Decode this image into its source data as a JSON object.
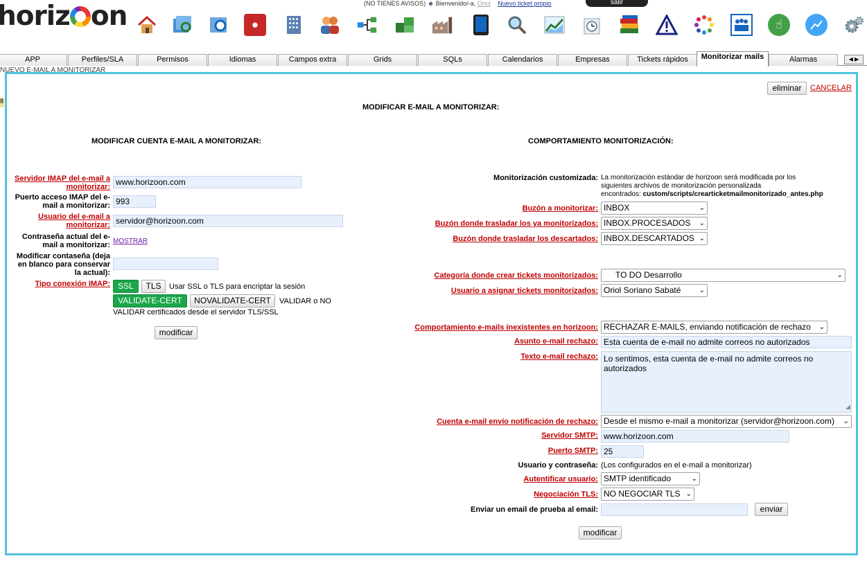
{
  "header": {
    "logo_text": "horizoon",
    "notices": "(NO TIENES AVISOS)",
    "welcome": "Bienvenido/-a,",
    "user": "Oriol",
    "new_ticket": "Nuevo ticket propio",
    "logout": "salir"
  },
  "toolbar_icons": [
    "home-icon",
    "search-images-icon",
    "search-list-icon",
    "map-marker-icon",
    "building-icon",
    "users-icon",
    "org-chart-icon",
    "boxes-icon",
    "factory-icon",
    "tablet-icon",
    "magnifier-icon",
    "chart-icon",
    "clock-icon",
    "books-icon",
    "warning-icon",
    "dots-circle-icon",
    "team-icon",
    "touch-icon",
    "trend-icon",
    "gears-icon"
  ],
  "tabs": [
    "APP",
    "Perfiles/SLA",
    "Permisos",
    "Idiomas",
    "Campos extra",
    "Grids",
    "SQLs",
    "Calendarios",
    "Empresas",
    "Tickets rápidos",
    "Monitorizar mails",
    "Alarmas"
  ],
  "active_tab": "Monitorizar mails",
  "breadcrumb": "NUEVO E-MAIL A MONITORIZAR",
  "page": {
    "delete_label": "eliminar",
    "cancel_label": "CANCELAR",
    "main_title": "MODIFICAR E-MAIL A MONITORIZAR:"
  },
  "left": {
    "title": "MODIFICAR CUENTA E-MAIL A MONITORIZAR:",
    "imap_server_label": "Servidor IMAP del e-mail a monitorizar:",
    "imap_server_value": "www.horizoon.com",
    "imap_port_label": "Puerto acceso IMAP del e-mail a monitorizar:",
    "imap_port_value": "993",
    "user_label": "Usuario del e-mail a monitorizar:",
    "user_value": "servidor@horizoon.com",
    "current_password_label": "Contraseña actual del e-mail a monitorizar:",
    "show_label": "MOSTRAR",
    "new_password_label": "Modificar contaseña (deja en blanco para conservar la actual):",
    "new_password_value": "",
    "conn_type_label": "Tipo conexión IMAP:",
    "ssl_label": "SSL",
    "tls_label": "TLS",
    "ssl_hint": "Usar SSL o TLS para encriptar la sesión",
    "validate_label": "VALIDATE-CERT",
    "novalidate_label": "NOVALIDATE-CERT",
    "validate_hint_1": "VALIDAR o NO",
    "validate_hint_2": "VALIDAR certificados desde el servidor TLS/SSL",
    "submit_label": "modificar"
  },
  "right": {
    "title": "COMPORTAMIENTO MONITORIZACIÓN:",
    "custom_label": "Monitorización customizada:",
    "custom_text_1": "La monitorización estándar de horizoon será modificada por los",
    "custom_text_2": "siguientes archivos de monitorización personalizada",
    "custom_text_3": "encontrados:",
    "custom_path": "custom/scripts/crearticketmailmonitorizado_antes.php",
    "mailbox_label": "Buzón a monitorizar:",
    "mailbox_value": "INBOX",
    "processed_label": "Buzón donde trasladar los ya monitorizados:",
    "processed_value": "INBOX.PROCESADOS",
    "discarded_label": "Buzón donde trasladar los descartados:",
    "discarded_value": "INBOX.DESCARTADOS",
    "category_label": "Categoría donde crear tickets monitorizados:",
    "category_value": "TO DO Desarrollo",
    "assign_label": "Usuario a asignar tickets monitorizados:",
    "assign_value": "Oriol Soriano Sabaté",
    "behaviour_label": "Comportamiento e-mails inexistentes en horizoon:",
    "behaviour_value": "RECHAZAR E-MAILS, enviando notificación de rechazo",
    "subject_label": "Asunto e-mail rechazo:",
    "subject_value": "Esta cuenta de e-mail no admite correos no autorizados",
    "body_label": "Texto e-mail rechazo:",
    "body_value": "Lo sentimos, esta cuenta de e-mail no admite correos no autorizados",
    "notify_account_label": "Cuenta e-mail envío notificación de rechazo:",
    "notify_account_value": "Desde el mismo e-mail a monitorizar (servidor@horizoon.com)",
    "smtp_server_label": "Servidor SMTP:",
    "smtp_server_value": "www.horizoon.com",
    "smtp_port_label": "Puerto SMTP:",
    "smtp_port_value": "25",
    "credentials_label": "Usuario y contraseña:",
    "credentials_value": "(Los configurados en el e-mail a monitorizar)",
    "auth_label": "Autentificar usuario:",
    "auth_value": "SMTP identificado",
    "tls_label": "Negociación TLS:",
    "tls_value": "NO NEGOCIAR TLS",
    "test_label": "Enviar un email de prueba al email:",
    "test_value": "",
    "send_label": "enviar",
    "submit_label": "modificar"
  },
  "colors": {
    "accent_border": "#4fc3dd",
    "required_label": "#c00000",
    "green_button": "#1aa64a",
    "field_bg": "#e8f0fe"
  }
}
